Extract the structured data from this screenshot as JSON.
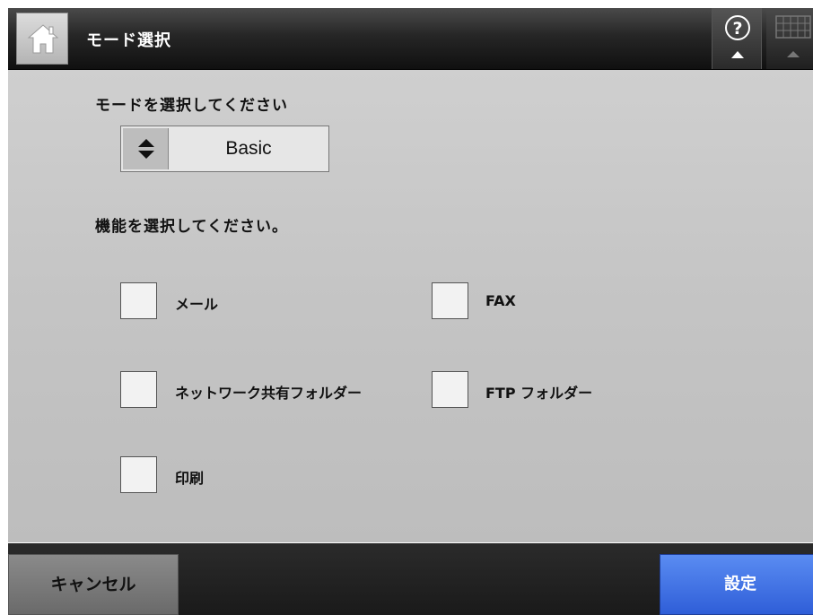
{
  "header": {
    "title": "モード選択",
    "home_icon": "home-icon",
    "help_icon": "help-icon",
    "keyboard_icon": "keyboard-icon"
  },
  "mode": {
    "prompt": "モードを選択してください",
    "selected": "Basic"
  },
  "functions": {
    "prompt": "機能を選択してください。",
    "options": [
      {
        "label": "メール",
        "checked": false
      },
      {
        "label": "FAX",
        "checked": false
      },
      {
        "label": "ネットワーク共有フォルダー",
        "checked": false
      },
      {
        "label": "FTP フォルダー",
        "checked": false
      },
      {
        "label": "印刷",
        "checked": false
      }
    ]
  },
  "footer": {
    "cancel_label": "キャンセル",
    "set_label": "設定"
  },
  "colors": {
    "header_bg": "#1a1a1a",
    "content_bg": "#c8c8c8",
    "set_button": "#3a6ae0"
  }
}
